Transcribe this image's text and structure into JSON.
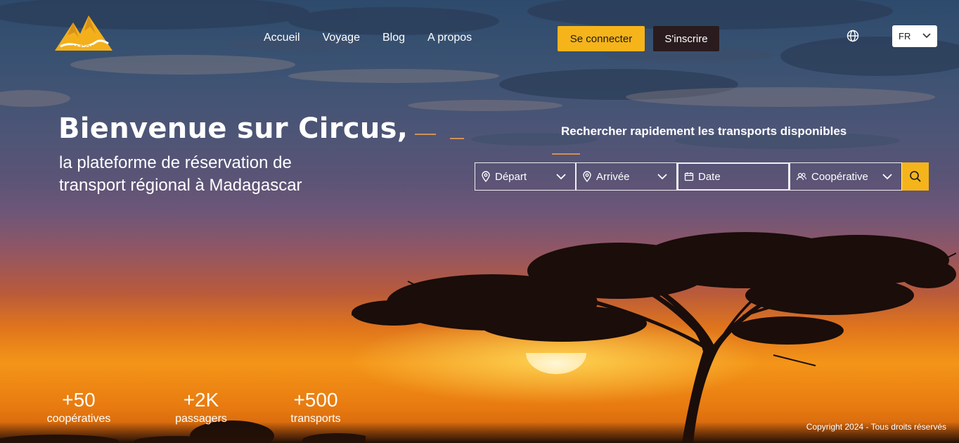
{
  "brand": {
    "name": "circus",
    "color": "#f3b01b"
  },
  "nav": {
    "items": [
      {
        "label": "Accueil"
      },
      {
        "label": "Voyage"
      },
      {
        "label": "Blog"
      },
      {
        "label": "A propos"
      }
    ]
  },
  "auth": {
    "login_label": "Se connecter",
    "signup_label": "S'inscrire"
  },
  "language": {
    "selected": "FR"
  },
  "hero": {
    "title": "Bienvenue sur Circus,",
    "subtitle": "la plateforme de réservation de transport régional à Madagascar"
  },
  "search": {
    "title": "Rechercher rapidement les transports disponibles",
    "departure_label": "Départ",
    "arrival_label": "Arrivée",
    "date_label": "Date",
    "cooperative_label": "Coopérative"
  },
  "stats": [
    {
      "value": "+50",
      "label": "coopératives"
    },
    {
      "value": "+2K",
      "label": "passagers"
    },
    {
      "value": "+500",
      "label": "transports"
    }
  ],
  "footer": {
    "copyright": "Copyright 2024 - Tous droits réservés"
  },
  "colors": {
    "accent": "#f6b41b",
    "dark_button": "#2a1b1e"
  }
}
